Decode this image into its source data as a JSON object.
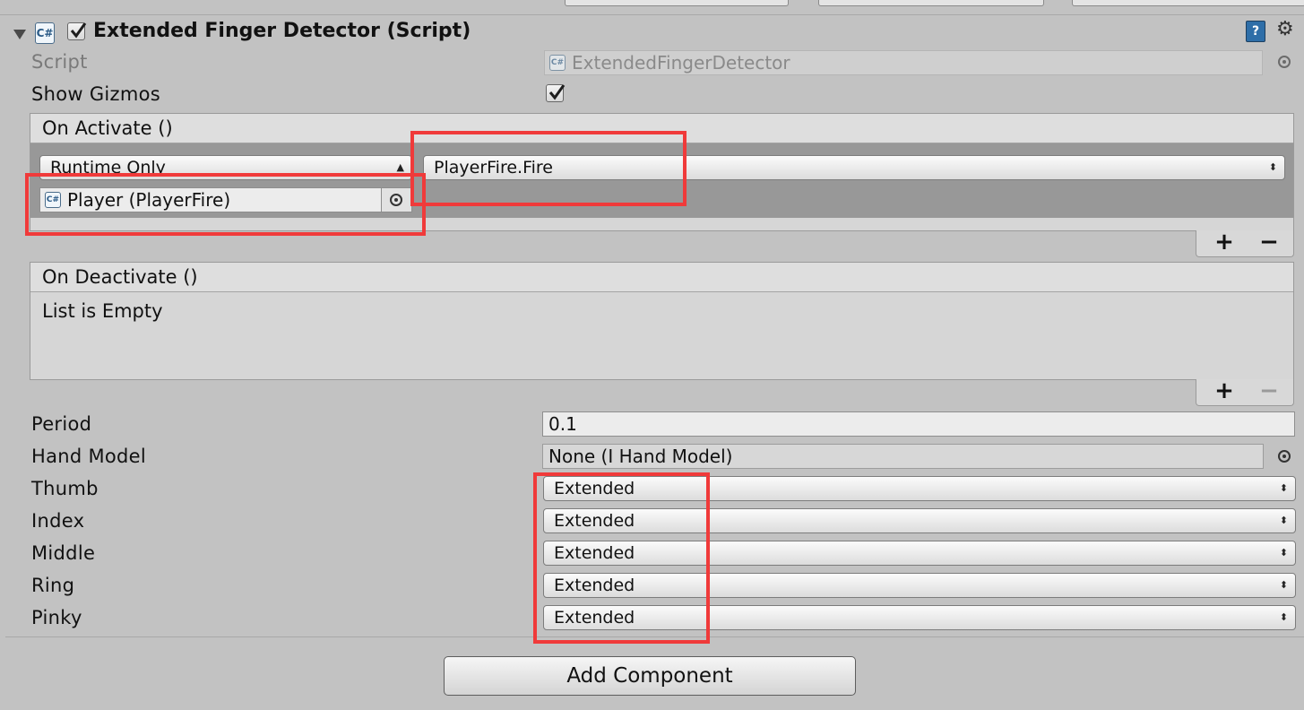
{
  "component": {
    "title": "Extended Finger Detector (Script)",
    "icon": "csharp-script-icon"
  },
  "script_row": {
    "label": "Script",
    "value": "ExtendedFingerDetector"
  },
  "show_gizmos": {
    "label": "Show Gizmos",
    "checked": true
  },
  "on_activate": {
    "header": "On Activate ()",
    "mode": "Runtime Only",
    "function": "PlayerFire.Fire",
    "target": "Player (PlayerFire)",
    "add": "+",
    "remove": "−"
  },
  "on_deactivate": {
    "header": "On Deactivate ()",
    "empty_text": "List is Empty",
    "add": "+",
    "remove": "−"
  },
  "period": {
    "label": "Period",
    "value": "0.1"
  },
  "hand_model": {
    "label": "Hand Model",
    "value": "None (I Hand Model)"
  },
  "fingers": [
    {
      "label": "Thumb",
      "value": "Extended"
    },
    {
      "label": "Index",
      "value": "Extended"
    },
    {
      "label": "Middle",
      "value": "Extended"
    },
    {
      "label": "Ring",
      "value": "Extended"
    },
    {
      "label": "Pinky",
      "value": "Extended"
    }
  ],
  "add_component": "Add Component",
  "colors": {
    "highlight": "#f03a3a",
    "background": "#c2c2c2"
  }
}
